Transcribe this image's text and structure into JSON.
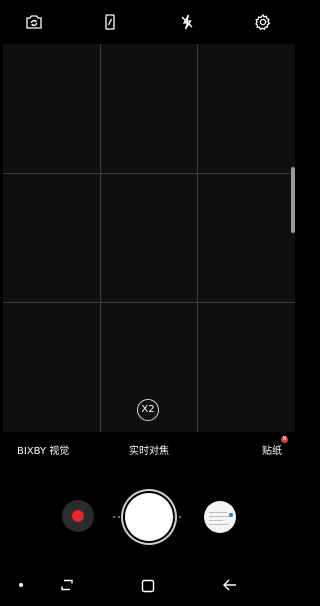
{
  "modes": {
    "left": "BIXBY 视觉",
    "center": "实时对焦",
    "right": "贴纸",
    "right_badge": "N"
  },
  "zoom": {
    "label": "X2"
  },
  "colors": {
    "record": "#e8262c",
    "badge": "#e23b3b",
    "grid": "#3c3c3c"
  },
  "icons": {
    "top": [
      "switch-camera-icon",
      "aspect-ratio-icon",
      "flash-off-icon",
      "settings-gear-icon"
    ],
    "nav": [
      "nav-dot-icon",
      "recent-apps-icon",
      "home-icon",
      "back-arrow-icon"
    ]
  }
}
